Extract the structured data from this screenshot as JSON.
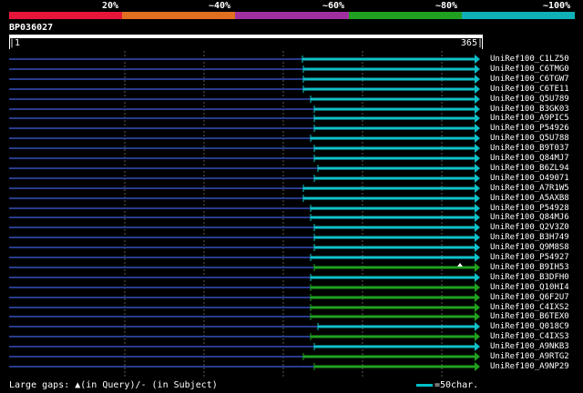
{
  "legend": {
    "ticks": [
      "20%",
      "~40%",
      "~60%",
      "~80%",
      "~100%"
    ],
    "colors": [
      "#e8153a",
      "#e07020",
      "#a030a0",
      "#20a020",
      "#10b0b8"
    ]
  },
  "query": {
    "title": "BP036027",
    "start": "|1",
    "end": "365|"
  },
  "line_colors": {
    "cyan": "#10c0c8",
    "green": "#20a020",
    "dash": "#283c8c"
  },
  "hits": [
    {
      "label": "UniRef100_C1LZ50",
      "start": 332,
      "color": "cyan"
    },
    {
      "label": "UniRef100_C6TMG0",
      "start": 333,
      "color": "cyan"
    },
    {
      "label": "UniRef100_C6TGW7",
      "start": 333,
      "color": "cyan"
    },
    {
      "label": "UniRef100_C6TE11",
      "start": 333,
      "color": "cyan"
    },
    {
      "label": "UniRef100_Q5U789",
      "start": 341,
      "color": "cyan"
    },
    {
      "label": "UniRef100_B3GK03",
      "start": 345,
      "color": "cyan"
    },
    {
      "label": "UniRef100_A9PIC5",
      "start": 345,
      "color": "cyan"
    },
    {
      "label": "UniRef100_P54926",
      "start": 345,
      "color": "cyan"
    },
    {
      "label": "UniRef100_Q5U788",
      "start": 341,
      "color": "cyan"
    },
    {
      "label": "UniRef100_B9T037",
      "start": 345,
      "color": "cyan"
    },
    {
      "label": "UniRef100_Q84MJ7",
      "start": 345,
      "color": "cyan"
    },
    {
      "label": "UniRef100_B6ZL94",
      "start": 349,
      "color": "cyan"
    },
    {
      "label": "UniRef100_O49071",
      "start": 345,
      "color": "cyan"
    },
    {
      "label": "UniRef100_A7R1W5",
      "start": 333,
      "color": "cyan"
    },
    {
      "label": "UniRef100_A5AXB8",
      "start": 333,
      "color": "cyan"
    },
    {
      "label": "UniRef100_P54928",
      "start": 341,
      "color": "cyan"
    },
    {
      "label": "UniRef100_Q84MJ6",
      "start": 341,
      "color": "cyan"
    },
    {
      "label": "UniRef100_Q2V3Z0",
      "start": 345,
      "color": "cyan"
    },
    {
      "label": "UniRef100_B3H749",
      "start": 345,
      "color": "cyan"
    },
    {
      "label": "UniRef100_Q9M8S8",
      "start": 345,
      "color": "cyan"
    },
    {
      "label": "UniRef100_P54927",
      "start": 341,
      "color": "cyan"
    },
    {
      "label": "UniRef100_B9IH53",
      "start": 345,
      "color": "green",
      "gap_marker": true
    },
    {
      "label": "UniRef100_B3DFH0",
      "start": 341,
      "color": "cyan"
    },
    {
      "label": "UniRef100_Q10HI4",
      "start": 341,
      "color": "green"
    },
    {
      "label": "UniRef100_Q6F2U7",
      "start": 341,
      "color": "green"
    },
    {
      "label": "UniRef100_C4IXS2",
      "start": 341,
      "color": "green"
    },
    {
      "label": "UniRef100_B6TEX0",
      "start": 341,
      "color": "green"
    },
    {
      "label": "UniRef100_Q018C9",
      "start": 349,
      "color": "cyan"
    },
    {
      "label": "UniRef100_C4IXS3",
      "start": 341,
      "color": "green"
    },
    {
      "label": "UniRef100_A9NKB3",
      "start": 345,
      "color": "cyan"
    },
    {
      "label": "UniRef100_A9RTG2",
      "start": 333,
      "color": "green"
    },
    {
      "label": "UniRef100_A9NP29",
      "start": 345,
      "color": "green"
    }
  ],
  "footer": {
    "legend_text": "Large gaps: ▲(in Query)/- (in Subject)",
    "scale_text": "=50char."
  }
}
